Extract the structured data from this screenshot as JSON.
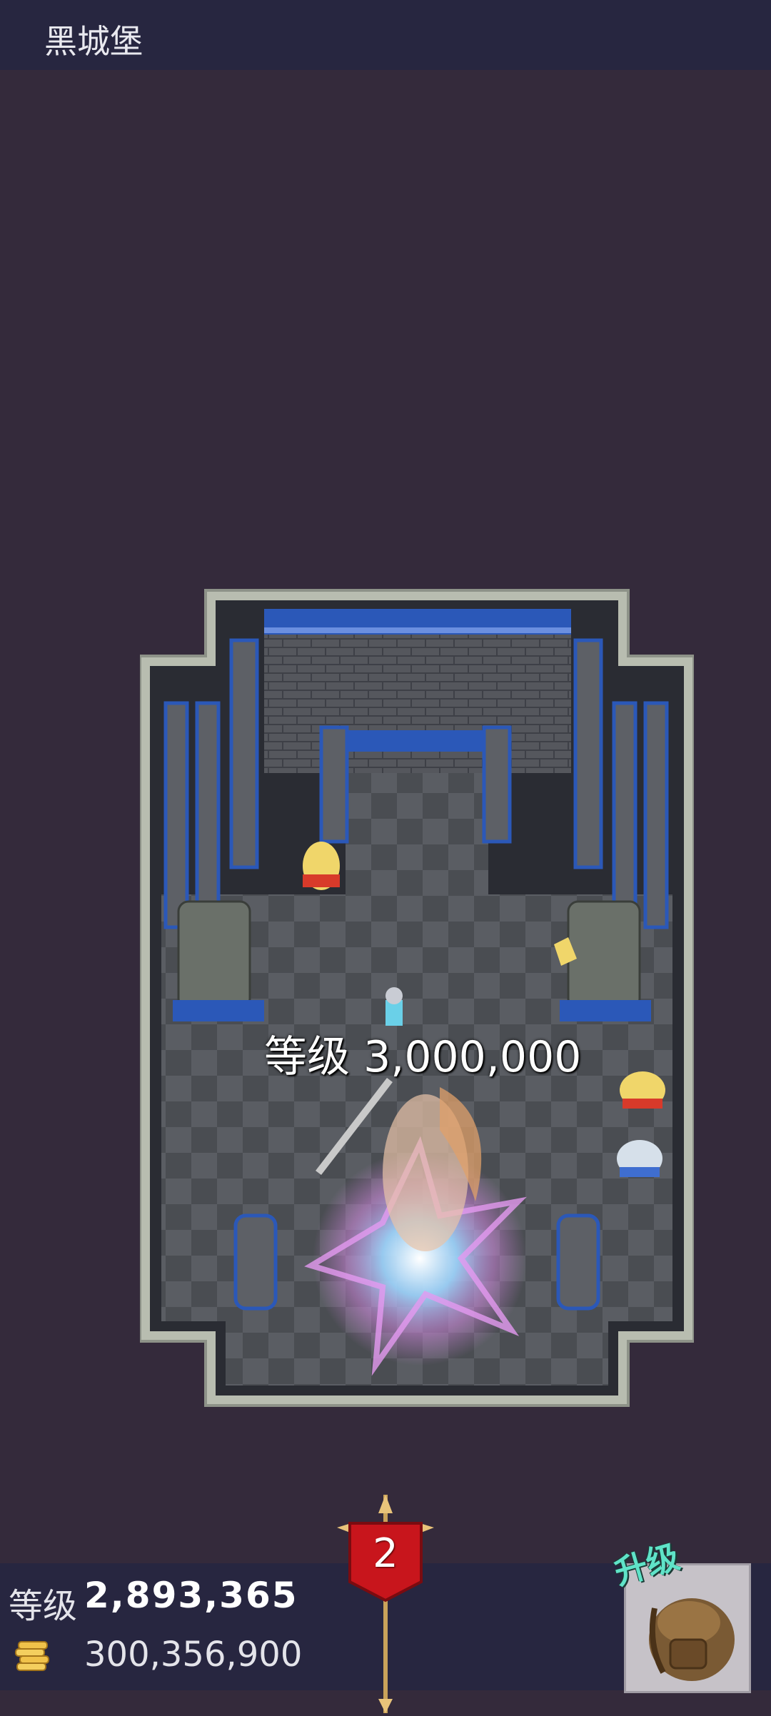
{
  "header": {
    "title": "黑城堡"
  },
  "room": {
    "required_level_label": "等级 3,000,000"
  },
  "player": {
    "level_label": "等级",
    "level_value": "2,893,365",
    "gold_value": "300,356,900",
    "gold_icon": "gold-coins-icon"
  },
  "banner": {
    "number": "2"
  },
  "upgrade": {
    "label": "升级",
    "icon": "backpack-icon"
  },
  "colors": {
    "background": "#342a3b",
    "bar": "#272640",
    "upgrade_text": "#5fe3c8",
    "banner_red": "#c8151c"
  }
}
